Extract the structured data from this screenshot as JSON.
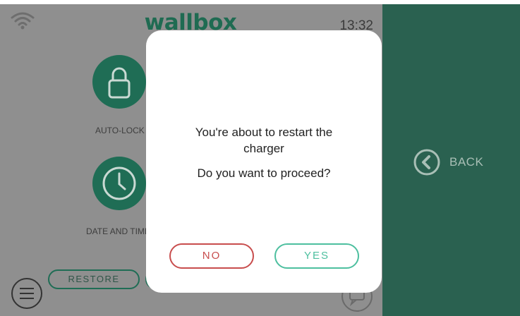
{
  "status_bar": {
    "wifi_icon": "wifi-icon",
    "logo": "wallbox",
    "time": "13:32"
  },
  "menu": {
    "tiles": [
      {
        "label": "AUTO-LOCK",
        "icon": "lock-icon"
      },
      {
        "label": "DATE AND TIME",
        "icon": "clock-icon"
      }
    ],
    "restore_label": "RESTORE",
    "hamburger_icon": "menu-icon",
    "chat_icon": "chat-icon"
  },
  "side_panel": {
    "back_label": "BACK",
    "back_icon": "chevron-left-circle-icon"
  },
  "dialog": {
    "message": "You're about to restart the charger",
    "question": "Do you want to proceed?",
    "no_label": "NO",
    "yes_label": "YES"
  },
  "colors": {
    "brand_green": "#1f6d55",
    "side_panel": "#2a6150",
    "overlay_gray": "#8f8f8f",
    "no_red": "#c84d4d",
    "yes_teal": "#4dbf9f"
  }
}
